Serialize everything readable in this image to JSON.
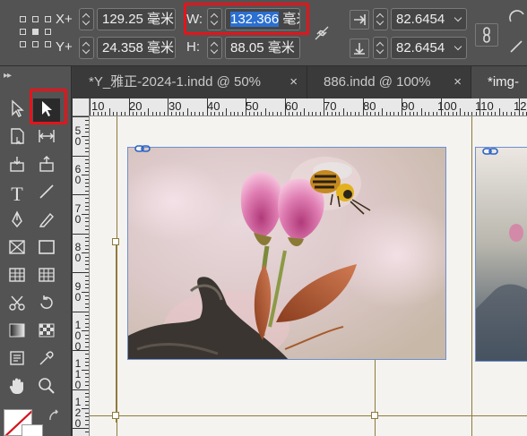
{
  "control_bar": {
    "x_label": "X+",
    "y_label": "Y+",
    "x_value": "129.25 毫米",
    "y_value": "24.358 毫米",
    "w_label": "W:",
    "h_label": "H:",
    "w_value_selected": "132.366",
    "w_value_rest": " 毫米",
    "h_value": "88.05 毫米",
    "scale_x_value": "82.6454",
    "scale_y_value": "82.6454"
  },
  "tabs": [
    {
      "label": "*Y_雅正-2024-1.indd @ 50%",
      "close": "×"
    },
    {
      "label": "886.indd @ 100%",
      "close": "×"
    },
    {
      "label": "*img-",
      "close": ""
    }
  ],
  "h_ruler": [
    "10",
    "20",
    "30",
    "40",
    "50",
    "60",
    "70",
    "80",
    "90",
    "100",
    "110",
    "12"
  ],
  "v_ruler": [
    "5\n0",
    "6\n0",
    "7\n0",
    "8\n0",
    "9\n0",
    "1\n0\n0",
    "1\n1\n0",
    "1\n2\n0"
  ],
  "colors": {
    "highlight": "#e3141b",
    "selection": "#2a6fd1",
    "frame_edge": "#6d8fd0",
    "guide": "#8e7a3c"
  },
  "icons": {
    "reference_point": "reference-point-grid-icon",
    "constrain": "constrain-proportions-icon",
    "scale_x": "scale-x-icon",
    "scale_y": "scale-y-icon",
    "link": "link-icon"
  }
}
